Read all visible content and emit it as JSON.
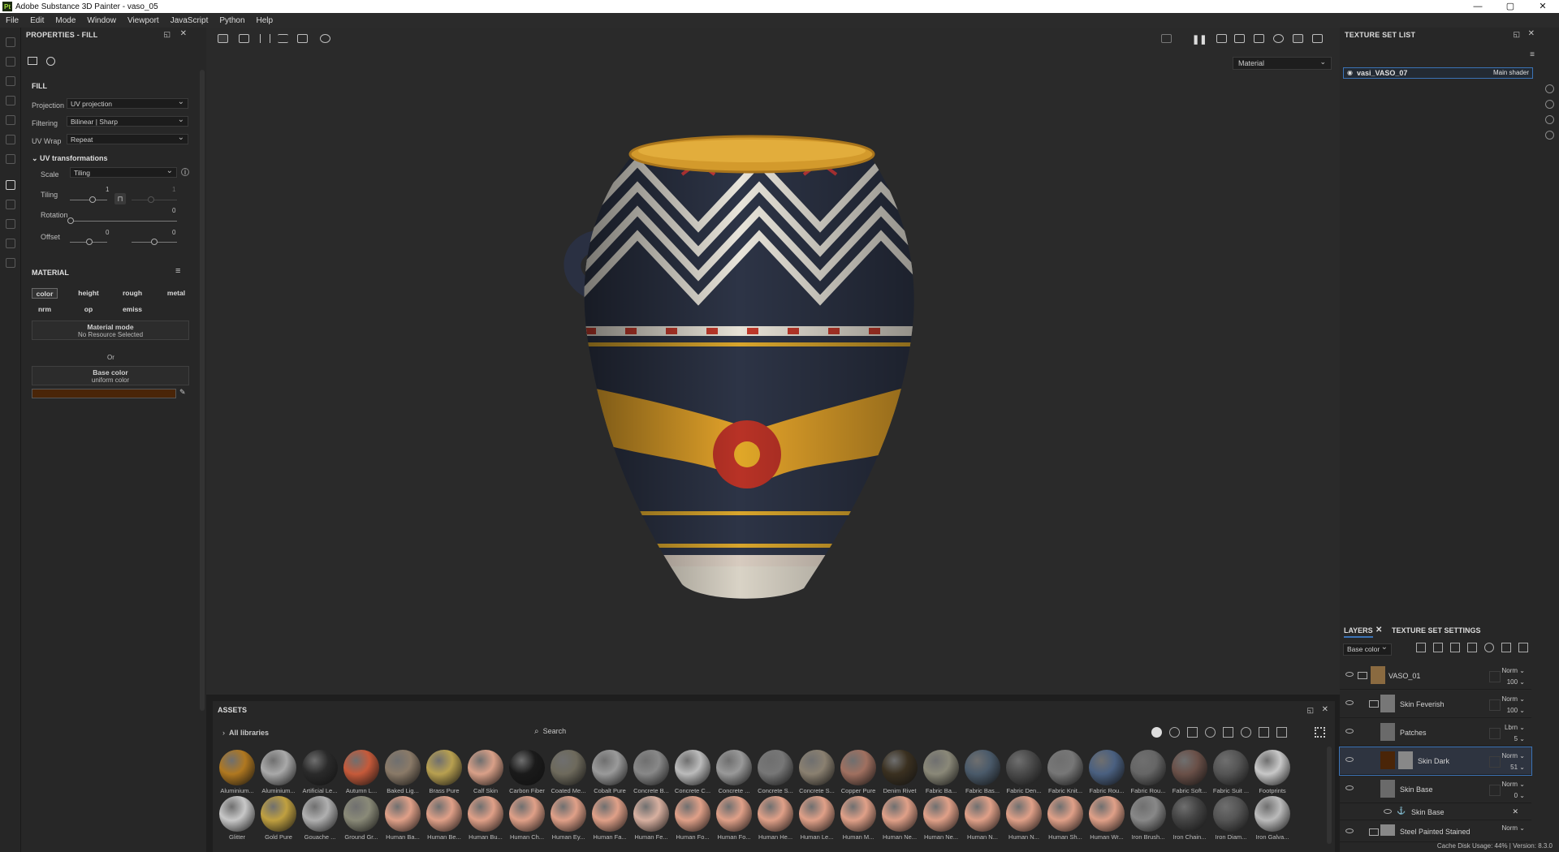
{
  "window": {
    "title": "Adobe Substance 3D Painter - vaso_05",
    "logo": "Pt",
    "controls": [
      "—",
      "▢",
      "✕"
    ]
  },
  "menu": [
    "File",
    "Edit",
    "Mode",
    "Window",
    "Viewport",
    "JavaScript",
    "Python",
    "Help"
  ],
  "properties": {
    "title": "PROPERTIES - FILL",
    "fill_label": "FILL",
    "projection_label": "Projection",
    "projection_value": "UV projection",
    "filtering_label": "Filtering",
    "filtering_value": "Bilinear | Sharp",
    "uvwrap_label": "UV Wrap",
    "uvwrap_value": "Repeat",
    "uv_transform_label": "UV transformations",
    "scale_label": "Scale",
    "scale_value": "Tiling",
    "tiling_label": "Tiling",
    "tiling_value": "1",
    "tiling_value2": "1",
    "rotation_label": "Rotation",
    "rotation_value": "0",
    "offset_label": "Offset",
    "offset_x": "0",
    "offset_y": "0",
    "material_label": "MATERIAL",
    "channels": [
      "color",
      "height",
      "rough",
      "metal",
      "nrm",
      "op",
      "emiss"
    ],
    "material_mode_title": "Material mode",
    "material_mode_value": "No Resource Selected",
    "or_label": "Or",
    "base_color_title": "Base color",
    "base_color_value": "uniform color",
    "base_color_swatch": "#4a2508"
  },
  "viewport": {
    "material_dropdown": "Material"
  },
  "texture_set": {
    "title": "TEXTURE SET LIST",
    "item": "vasi_VASO_07",
    "shader": "Main shader"
  },
  "layers": {
    "tab_layers": "LAYERS",
    "tab_settings": "TEXTURE SET SETTINGS",
    "channel": "Base color",
    "rows": [
      {
        "name": "VASO_01",
        "blend": "Norm",
        "opacity": "100"
      },
      {
        "name": "Skin Feverish",
        "blend": "Norm",
        "opacity": "100"
      },
      {
        "name": "Patches",
        "blend": "Lbrn",
        "opacity": "5"
      },
      {
        "name": "Skin Dark",
        "blend": "Norm",
        "opacity": "51"
      },
      {
        "name": "Skin Base",
        "blend": "Norm",
        "opacity": "0"
      },
      {
        "name": "Skin Base",
        "blend": "",
        "opacity": ""
      },
      {
        "name": "Steel Painted Stained",
        "blend": "Norm",
        "opacity": ""
      }
    ]
  },
  "assets": {
    "title": "ASSETS",
    "library": "All libraries",
    "search_placeholder": "Search",
    "row1": [
      "Aluminium...",
      "Aluminium...",
      "Artificial Le...",
      "Autumn L...",
      "Baked Lig...",
      "Brass Pure",
      "Calf Skin",
      "Carbon Fiber",
      "Coated Me...",
      "Cobalt Pure",
      "Concrete B...",
      "Concrete C...",
      "Concrete ...",
      "Concrete S...",
      "Concrete S...",
      "Copper Pure",
      "Denim Rivet",
      "Fabric Ba...",
      "Fabric Bas...",
      "Fabric Den...",
      "Fabric Knit...",
      "Fabric Rou...",
      "Fabric Rou...",
      "Fabric Soft...",
      "Fabric Suit ...",
      "Footprints"
    ],
    "row2": [
      "Glitter",
      "Gold Pure",
      "Gouache ...",
      "Ground Gr...",
      "Human Ba...",
      "Human Be...",
      "Human Bu...",
      "Human Ch...",
      "Human Ey...",
      "Human Fa...",
      "Human Fe...",
      "Human Fo...",
      "Human Fo...",
      "Human He...",
      "Human Le...",
      "Human M...",
      "Human Ne...",
      "Human Ne...",
      "Human N...",
      "Human N...",
      "Human Sh...",
      "Human Wr...",
      "Iron Brush...",
      "Iron Chain...",
      "Iron Diam...",
      "Iron Galva..."
    ]
  },
  "status": "Cache Disk Usage:  44% | Version: 8.3.0"
}
